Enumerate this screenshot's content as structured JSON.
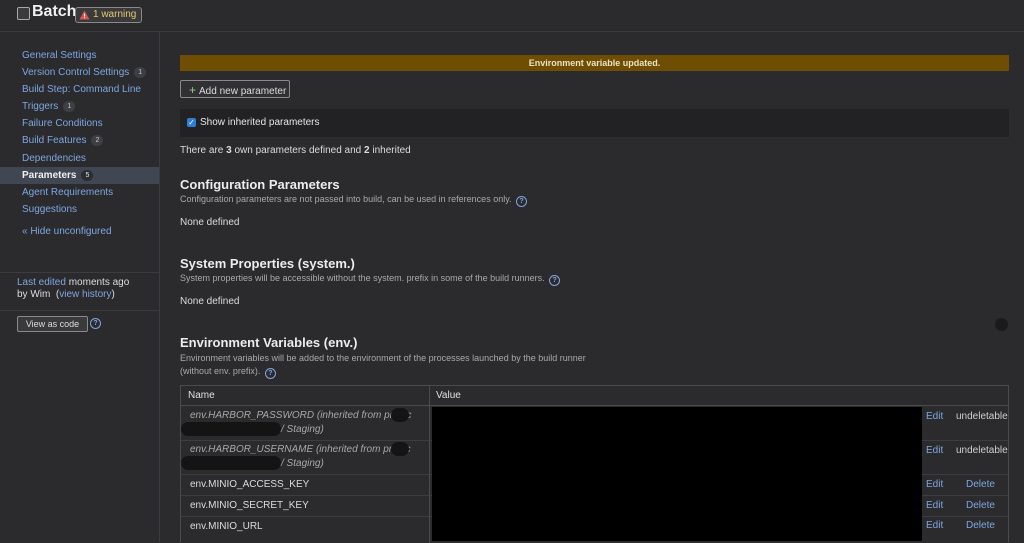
{
  "header": {
    "title": "Batch",
    "warning_label": "1 warning"
  },
  "sidebar": {
    "items": [
      {
        "label": "General Settings",
        "count": ""
      },
      {
        "label": "Version Control Settings",
        "count": "1"
      },
      {
        "label": "Build Step: Command Line",
        "count": ""
      },
      {
        "label": "Triggers",
        "count": "1"
      },
      {
        "label": "Failure Conditions",
        "count": ""
      },
      {
        "label": "Build Features",
        "count": "2"
      },
      {
        "label": "Dependencies",
        "count": ""
      },
      {
        "label": "Parameters",
        "count": "5"
      },
      {
        "label": "Agent Requirements",
        "count": ""
      },
      {
        "label": "Suggestions",
        "count": ""
      }
    ],
    "active_item": "Parameters",
    "hide_unconfigured": "« Hide unconfigured",
    "last_edited": {
      "prefix": "Last edited",
      "when": " moments ago",
      "by": "by Wim",
      "open_paren": "  (",
      "view_history": "view history",
      "close_paren": ")"
    },
    "view_as_code": "View as code"
  },
  "main": {
    "success_message": "Environment variable updated.",
    "add_button": "Add new parameter",
    "show_inherited": {
      "label": "Show inherited parameters",
      "checked": true
    },
    "count_line": {
      "pre": "There are ",
      "own": "3",
      "mid": " own parameters defined and ",
      "inherited": "2",
      "post": " inherited"
    },
    "config": {
      "title": "Configuration Parameters",
      "desc": "Configuration parameters are not passed into build, can be used in references only.",
      "empty": "None defined"
    },
    "system": {
      "title": "System Properties (system.)",
      "desc": "System properties will be accessible without the system. prefix in some of the build runners.",
      "empty": "None defined"
    },
    "env": {
      "title": "Environment Variables (env.)",
      "desc_line1": "Environment variables will be added to the environment of the processes launched by the build runner",
      "desc_line2": "(without env. prefix).",
      "columns": {
        "name": "Name",
        "value": "Value"
      },
      "rows": [
        {
          "name_line1": "env.HARBOR_PASSWORD (inherited from projec",
          "name_line2": "/ Staging)",
          "edit": "Edit",
          "action": "undeletable"
        },
        {
          "name_line1": "env.HARBOR_USERNAME (inherited from projec",
          "name_line2": "/ Staging)",
          "edit": "Edit",
          "action": "undeletable"
        },
        {
          "name_line1": "env.MINIO_ACCESS_KEY",
          "edit": "Edit",
          "action": "Delete"
        },
        {
          "name_line1": "env.MINIO_SECRET_KEY",
          "edit": "Edit",
          "action": "Delete"
        },
        {
          "name_line1": "env.MINIO_URL",
          "edit": "Edit",
          "action": "Delete"
        }
      ]
    }
  },
  "colors": {
    "background": "#2b2b2e",
    "link": "#7ea6e0",
    "success_bar": "#6f4e03",
    "warning_text": "#e6c96a",
    "checkbox_accent": "#2f7dd6"
  }
}
